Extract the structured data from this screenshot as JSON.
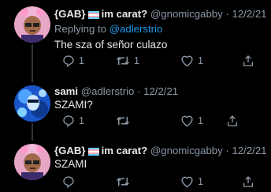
{
  "tweets": [
    {
      "display_name": "{GAB}",
      "name_suffix": "im carat?",
      "handle": "@gnomicgabby",
      "separator": "·",
      "date": "12/2/21",
      "replying_prefix": "Replying to",
      "replying_to": "@adlerstrio",
      "text": "The sza of señor culazo",
      "reply_count": "1",
      "retweet_count": "1",
      "like_count": "1"
    },
    {
      "display_name": "sami",
      "handle": "@adlerstrio",
      "separator": "·",
      "date": "12/2/21",
      "text": "SZAMI?",
      "reply_count": "1",
      "retweet_count": "",
      "like_count": "1"
    },
    {
      "display_name": "{GAB}",
      "name_suffix": "im carat?",
      "handle": "@gnomicgabby",
      "separator": "·",
      "date": "12/2/21",
      "text": "SZAMI",
      "reply_count": "",
      "retweet_count": "",
      "like_count": "1"
    }
  ],
  "icons": {
    "reply": "reply-icon",
    "retweet": "retweet-icon",
    "like": "heart-icon",
    "share": "share-icon",
    "flag": "transgender-flag-icon"
  },
  "colors": {
    "background": "#000000",
    "text": "#e7e9ea",
    "secondary": "#8b98a5",
    "link": "#1d9bf0",
    "thread_line": "#333639"
  }
}
